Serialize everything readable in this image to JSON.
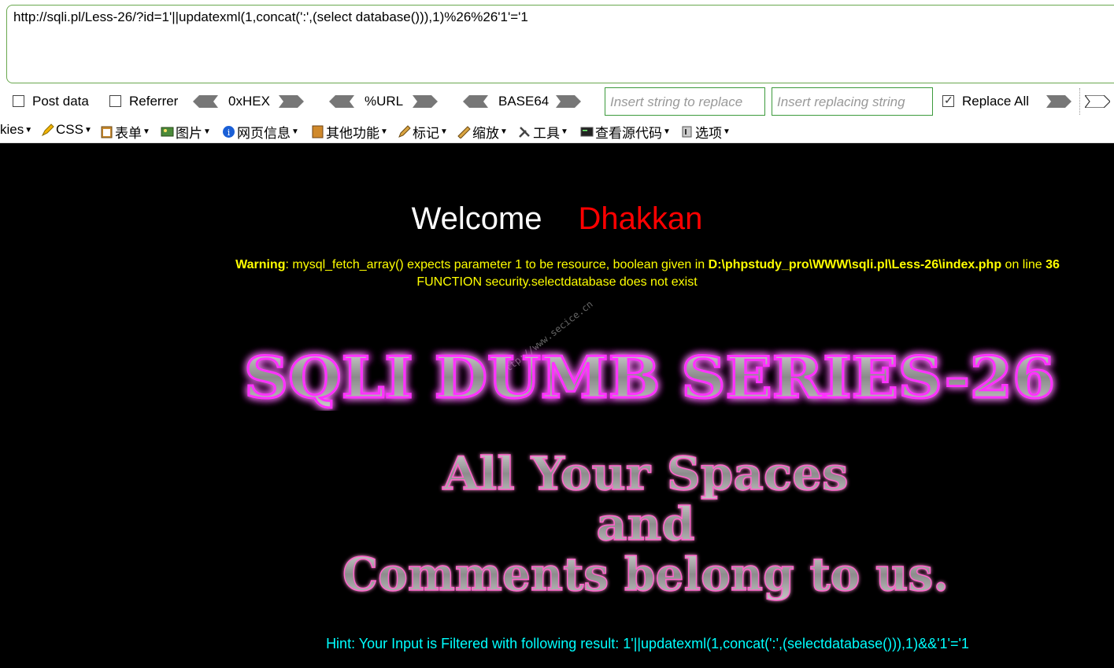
{
  "hackbar": {
    "url": "http://sqli.pl/Less-26/?id=1'||updatexml(1,concat(':',(select database())),1)%26%26'1'='1",
    "post_data_label": "Post data",
    "referrer_label": "Referrer",
    "hex_label": "0xHEX",
    "url_label": "%URL",
    "base64_label": "BASE64",
    "replace_placeholder": "Insert string to replace",
    "replacing_placeholder": "Insert replacing string",
    "replace_all_label": "Replace All",
    "replace_all_checked": true
  },
  "toolbar": {
    "cookies": "kies",
    "css": "CSS",
    "forms": "表单",
    "images": "图片",
    "info": "网页信息",
    "misc": "其他功能",
    "outline": "标记",
    "resize": "缩放",
    "tools": "工具",
    "source": "查看源代码",
    "options": "选项"
  },
  "page": {
    "welcome": "Welcome",
    "name": "Dhakkan",
    "warning_bold": "Warning",
    "warning_text": ": mysql_fetch_array() expects parameter 1 to be resource, boolean given in ",
    "warning_path": "D:\\phpstudy_pro\\WWW\\sqli.pl\\Less-26\\index.php",
    "warning_on_line": " on line ",
    "warning_line": "36",
    "error": "FUNCTION security.selectdatabase does not exist",
    "watermark": "http://www.secice.cn",
    "title_art": "SQLI DUMB SERIES-26",
    "subtitle_line1": "All Your Spaces",
    "subtitle_line2": "and",
    "subtitle_line3": "Comments belong to us.",
    "hint": "Hint: Your Input is Filtered with following result: 1'||updatexml(1,concat(':',(selectdatabase())),1)&&'1'='1"
  },
  "colors": {
    "background": "#000000",
    "welcome": "#ffffff",
    "name": "#ff0000",
    "warning": "#ffff00",
    "hint": "#00ffff",
    "title_glow": "#ff00ff"
  }
}
